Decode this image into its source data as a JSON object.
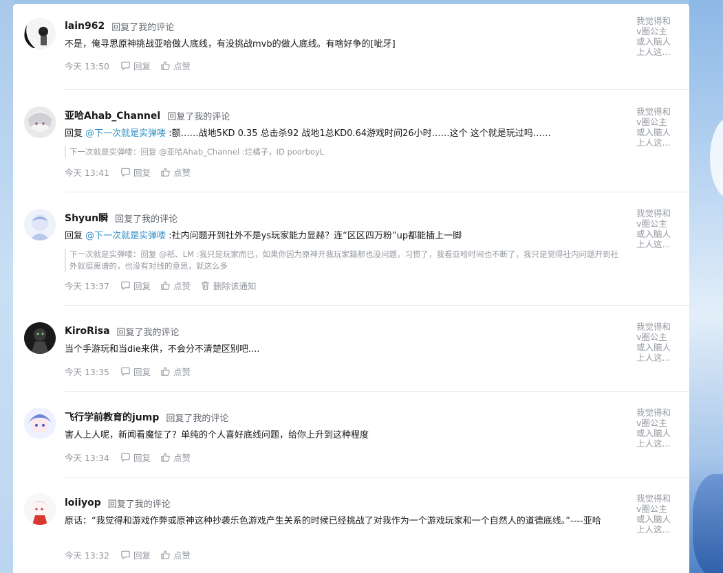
{
  "common": {
    "action": "回复了我的评论",
    "reply_label": "回复",
    "like_label": "点赞",
    "delete_label": "删除该通知"
  },
  "items": [
    {
      "name": "lain962",
      "content": "不是，俺寻思原神挑战亚哈做人底线，有没挑战mvb的做人底线。有啥好争的[呲牙]",
      "time": "今天 13:50",
      "side": [
        "我觉得和",
        "v圈公主",
        "或入脑人",
        "上人这..."
      ]
    },
    {
      "name": "亚哈Ahab_Channel",
      "content_prefix": "回复 ",
      "mention": "@下一次就是实弹喽",
      "content_rest": " :额……战地5KD 0.35 总击杀92 战地1总KD0.64游戏时间26小时……这个 这个就是玩过吗……",
      "quote": "下一次就是实弹喽：回复 @亚哈Ahab_Channel :烂橘子，ID poorboyL",
      "time": "今天 13:41",
      "side": [
        "我觉得和",
        "v圈公主",
        "或入脑人",
        "上人这..."
      ]
    },
    {
      "name": "Shyun瞬",
      "content_prefix": "回复 ",
      "mention": "@下一次就是实弹喽",
      "content_rest": " :社内问题开到社外不是ys玩家能力显赫？连“区区四万粉”up都能插上一脚",
      "quote": "下一次就是实弹喽：回复 @祇、LM :我只是玩家而已，如果你因为原神开我玩家籍那也没问题，习惯了，我看亚哈时间也不断了，我只是觉得社内问题开到社外就挺离谱的，也没有对线的意思，就这么多",
      "time": "今天 13:37",
      "side": [
        "我觉得和",
        "v圈公主",
        "或入脑人",
        "上人这..."
      ]
    },
    {
      "name": "KiroRisa",
      "content": "当个手游玩和当die来供，不会分不清楚区别吧....",
      "time": "今天 13:35",
      "side": [
        "我觉得和",
        "v圈公主",
        "或入脑人",
        "上人这..."
      ]
    },
    {
      "name": "飞行学前教育的jump",
      "content": "害人上人呢，新闻看魔怔了？单纯的个人喜好底线问题，给你上升到这种程度",
      "time": "今天 13:34",
      "side": [
        "我觉得和",
        "v圈公主",
        "或入脑人",
        "上人这..."
      ]
    },
    {
      "name": "loiiyop",
      "content": "原话：“我觉得和游戏作弊或原神这种抄袭乐色游戏产生关系的时候已经挑战了对我作为一个游戏玩家和一个自然人的道德底线。”----亚哈",
      "time": "今天 13:32",
      "side": [
        "我觉得和",
        "v圈公主",
        "或入脑人",
        "上人这..."
      ]
    }
  ]
}
